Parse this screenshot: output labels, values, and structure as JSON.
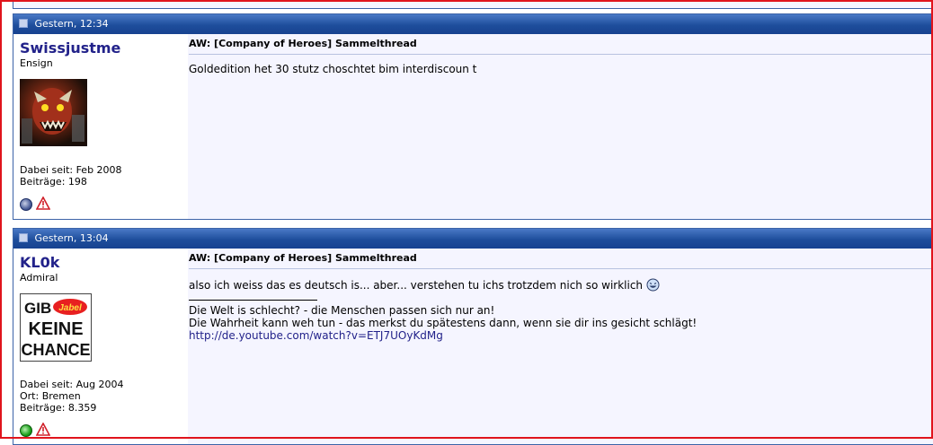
{
  "posts": [
    {
      "timestamp": "Gestern, 12:34",
      "username": "Swissjustme",
      "usertitle": "Ensign",
      "stats": [
        "Dabei seit: Feb 2008",
        "Beiträge: 198"
      ],
      "online_status": "offline",
      "title": "AW: [Company of Heroes] Sammelthread",
      "text": "Goldedition het 30 stutz choschtet bim interdiscoun t"
    },
    {
      "timestamp": "Gestern, 13:04",
      "username": "KL0k",
      "usertitle": "Admiral",
      "avatar_text": {
        "top": "GIB",
        "badge": "Jabel",
        "middle": "KEINE",
        "bottom": "CHANCE"
      },
      "stats": [
        "Dabei seit: Aug 2004",
        "Ort: Bremen",
        "Beiträge: 8.359"
      ],
      "online_status": "online",
      "title": "AW: [Company of Heroes] Sammelthread",
      "text": "also ich weiss das es deutsch is... aber... verstehen tu ichs trotzdem nich so wirklich",
      "signature": [
        "Die Welt is schlecht? - die Menschen passen sich nur an!",
        "Die Wahrheit kann weh tun - das merkst du spätestens dann, wenn sie dir ins gesicht schlägt!"
      ],
      "link": "http://de.youtube.com/watch?v=ETJ7UOyKdMg"
    }
  ],
  "colors": {
    "header_bar": "#1e4e9c",
    "username": "#22228a",
    "frame": "#e0141c",
    "post_bg": "#f5f5ff"
  }
}
